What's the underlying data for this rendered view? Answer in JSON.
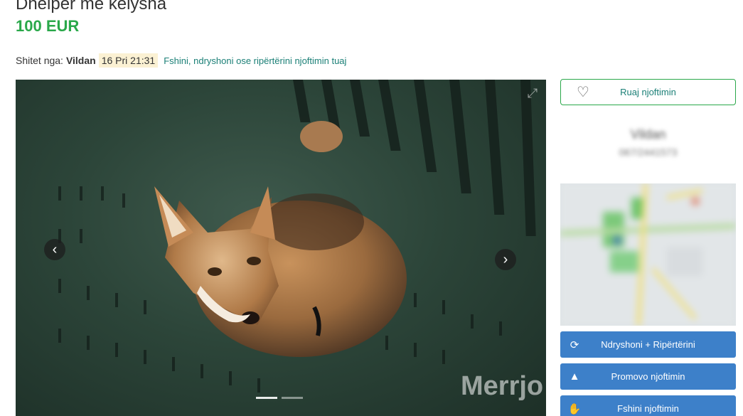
{
  "listing": {
    "title": "Dhelpër me këlysha",
    "price": "100 EUR"
  },
  "meta": {
    "sold_by_label": "Shitet nga:",
    "seller_name": "Vildan",
    "date": "16 Pri 21:31",
    "manage_link": "Fshini, ndryshoni ose ripërtërini njoftimin tuaj"
  },
  "gallery": {
    "watermark": "Merrjo",
    "slide_count": 2,
    "active_slide": 1,
    "icons": {
      "prev": "chevron-left-icon",
      "next": "chevron-right-icon",
      "expand": "expand-icon"
    }
  },
  "sidebar": {
    "save_label": "Ruaj njoftimin",
    "save_icon": "heart-icon",
    "seller_name": "Vildan",
    "seller_phone": "067/2441573",
    "actions": [
      {
        "label": "Ndryshoni + Ripërtërini",
        "icon": "refresh-icon"
      },
      {
        "label": "Promovo njoftimin",
        "icon": "rocket-icon"
      },
      {
        "label": "Fshini njoftimin",
        "icon": "hand-icon"
      }
    ]
  },
  "colors": {
    "price_green": "#2aa84a",
    "link_teal": "#1a7f76",
    "action_blue": "#3d80c9",
    "date_highlight": "#fbf1d3"
  }
}
